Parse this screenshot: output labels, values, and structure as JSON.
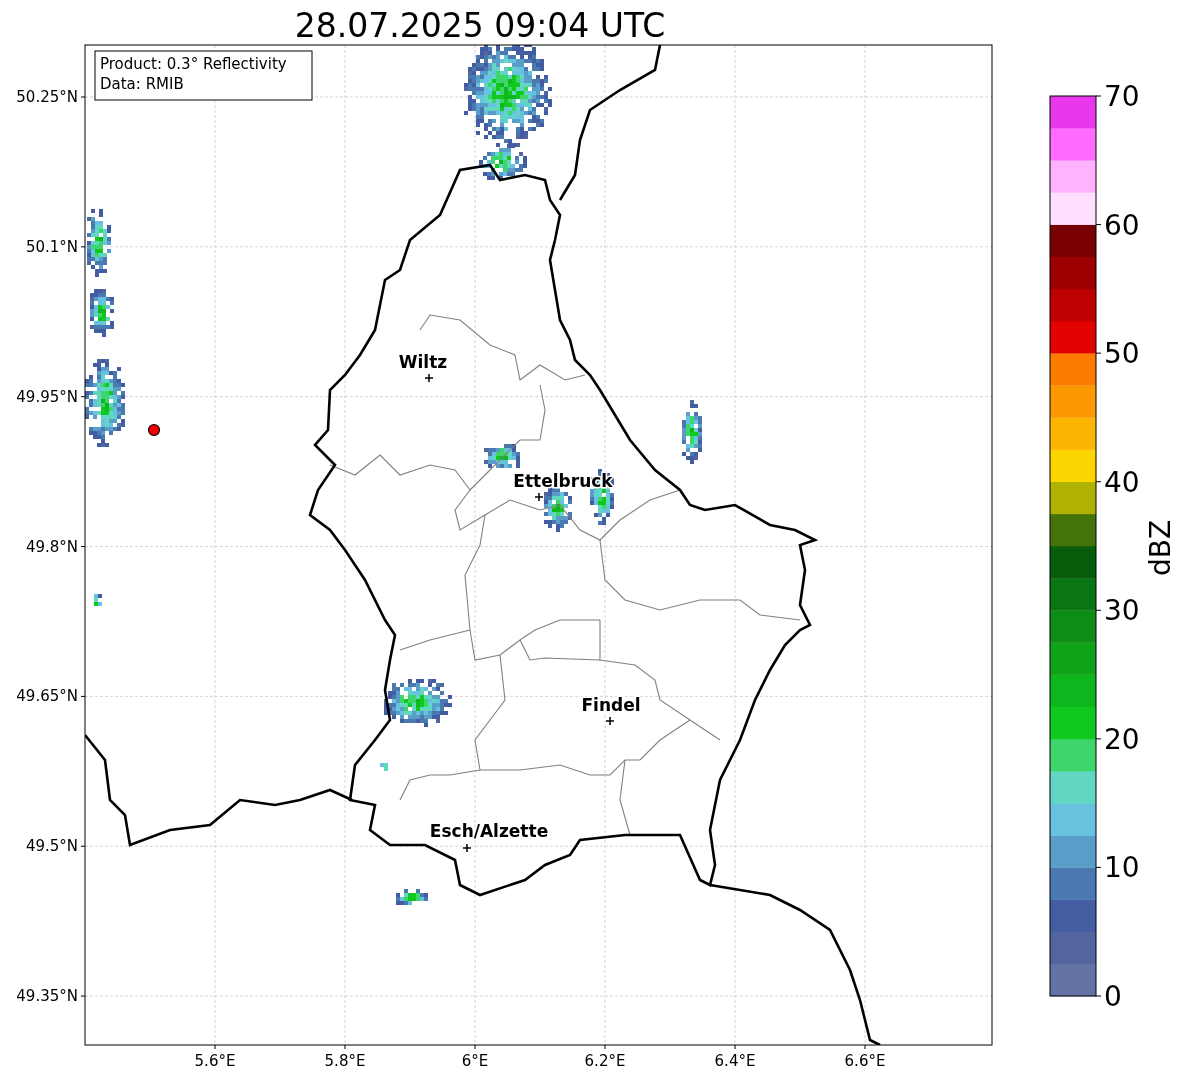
{
  "title": "28.07.2025 09:04 UTC",
  "info": [
    "Product: 0.3° Reflectivity",
    "Data: RMIB"
  ],
  "map": {
    "xticks": [
      "5.6°E",
      "5.8°E",
      "6°E",
      "6.2°E",
      "6.4°E",
      "6.6°E"
    ],
    "yticks": [
      "50.25°N",
      "50.1°N",
      "49.95°N",
      "49.8°N",
      "49.65°N",
      "49.5°N",
      "49.35°N"
    ],
    "cities": [
      {
        "name": "Wiltz"
      },
      {
        "name": "Ettelbruck"
      },
      {
        "name": "Findel"
      },
      {
        "name": "Esch/Alzette"
      }
    ]
  },
  "colorbar": {
    "label": "dBZ",
    "ticks": [
      "70",
      "60",
      "50",
      "40",
      "30",
      "20",
      "10",
      "0"
    ],
    "bins": [
      {
        "color": "#6373a5"
      },
      {
        "color": "#52659e"
      },
      {
        "color": "#435da3"
      },
      {
        "color": "#4a79b1"
      },
      {
        "color": "#599ec9"
      },
      {
        "color": "#66c2df"
      },
      {
        "color": "#61d6c3"
      },
      {
        "color": "#3dd66b"
      },
      {
        "color": "#10c81e"
      },
      {
        "color": "#0fb61e"
      },
      {
        "color": "#0fa317"
      },
      {
        "color": "#0d8c16"
      },
      {
        "color": "#097613"
      },
      {
        "color": "#075d0c"
      },
      {
        "color": "#447409"
      },
      {
        "color": "#afb103"
      },
      {
        "color": "#fdd500"
      },
      {
        "color": "#fdb503"
      },
      {
        "color": "#fd9900"
      },
      {
        "color": "#fd7b00"
      },
      {
        "color": "#e20200"
      },
      {
        "color": "#bf0000"
      },
      {
        "color": "#9c0000"
      },
      {
        "color": "#780000"
      },
      {
        "color": "#ffdfff"
      },
      {
        "color": "#ffb3ff"
      },
      {
        "color": "#ff6cff"
      },
      {
        "color": "#e838ec"
      }
    ]
  }
}
